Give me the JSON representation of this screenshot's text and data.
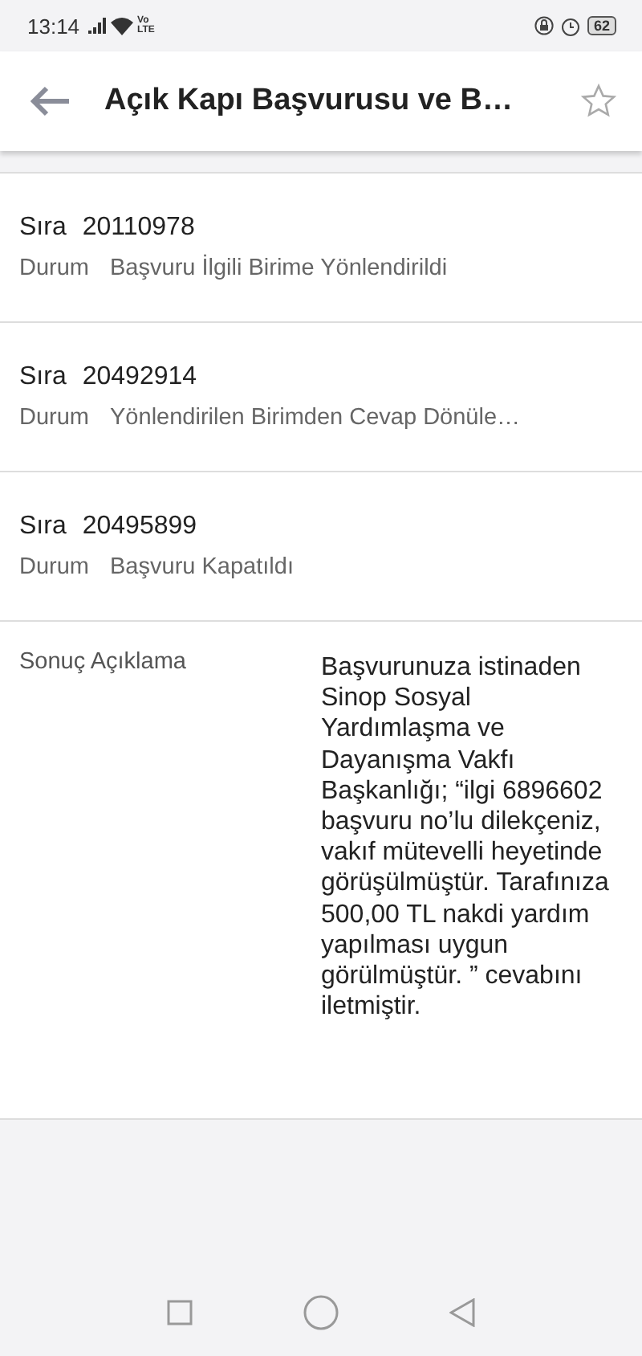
{
  "status_bar": {
    "time": "13:14",
    "network": "Vo LTE",
    "battery": "62"
  },
  "app_bar": {
    "title": "Açık Kapı Başvurusu ve B…",
    "favorite": false
  },
  "records": [
    {
      "sira_label": "Sıra",
      "sira": "20110978",
      "durum_label": "Durum",
      "durum": "Başvuru İlgili Birime Yönlendirildi"
    },
    {
      "sira_label": "Sıra",
      "sira": "20492914",
      "durum_label": "Durum",
      "durum": "Yönlendirilen Birimden Cevap Dönüle…"
    },
    {
      "sira_label": "Sıra",
      "sira": "20495899",
      "durum_label": "Durum",
      "durum": "Başvuru Kapatıldı"
    }
  ],
  "result": {
    "label": "Sonuç Açıklama",
    "text": "Başvurunuza istinaden Sinop Sosyal Yardımlaşma ve Dayanışma Vakfı Başkanlığı; “ilgi 6896602 başvuru no’lu dilekçeniz, vakıf mütevelli heyetinde görüşülmüştür. Tarafınıza 500,00 TL nakdi yardım yapılması uygun görülmüştür. ” cevabını iletmiştir."
  }
}
